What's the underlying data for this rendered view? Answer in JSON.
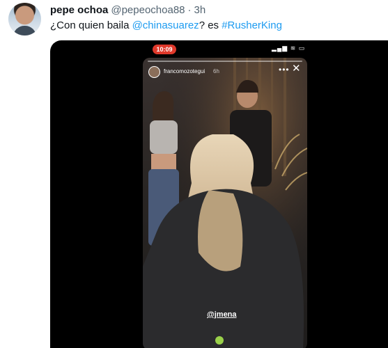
{
  "tweet": {
    "author_name": "pepe ochoa",
    "author_handle": "@pepeochoa88",
    "separator": "·",
    "time_ago": "3h",
    "text_before": "¿Con quien baila ",
    "mention": "@chinasuarez",
    "text_between": "? es ",
    "hashtag": "#RusherKing"
  },
  "phone": {
    "clock": "10:09",
    "status_icons": "▂▄▆ ≋ ▭"
  },
  "story": {
    "username": "francomozotegui",
    "time_ago": "6h",
    "menu_glyph": "•••",
    "close_glyph": "✕",
    "tag_text": "@jmena"
  },
  "colors": {
    "link": "#1d9bf0",
    "record_pill": "#e0392b"
  }
}
